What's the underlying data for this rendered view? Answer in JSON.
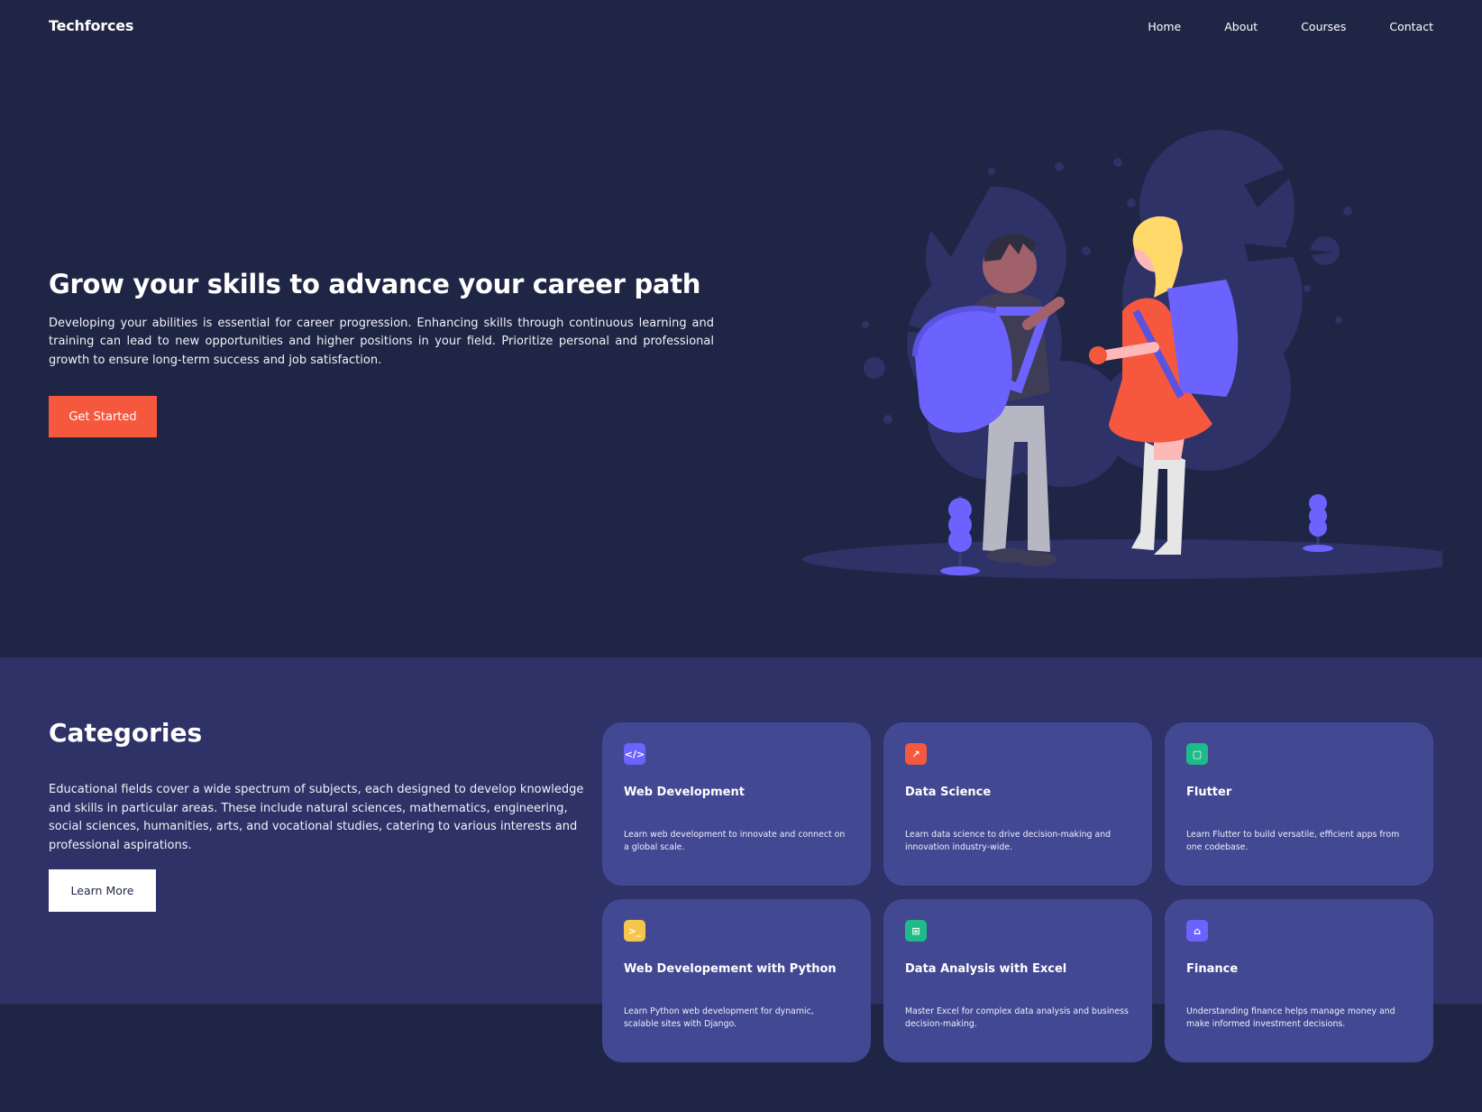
{
  "nav": {
    "brand": "Techforces",
    "links": [
      "Home",
      "About",
      "Courses",
      "Contact"
    ]
  },
  "hero": {
    "title": "Grow your skills to advance your career path",
    "description": "Developing your abilities is essential for career progression. Enhancing skills through continuous learning and training can lead to new opportunities and higher positions in your field. Prioritize personal and professional growth to ensure long-term success and job satisfaction.",
    "cta_label": "Get Started",
    "illustration": "two-students-with-backpacks"
  },
  "categories": {
    "title": "Categories",
    "description": "Educational fields cover a wide spectrum of subjects, each designed to develop knowledge and skills in particular areas. These include natural sciences, mathematics, engineering, social sciences, humanities, arts, and vocational studies, catering to various interests and professional aspirations.",
    "cta_label": "Learn More",
    "cards": [
      {
        "title": "Web Development",
        "description": "Learn web development to innovate and connect on a global scale.",
        "icon": "code-icon",
        "icon_color": "#6c63ff"
      },
      {
        "title": "Data Science",
        "description": "Learn data science to drive decision-making and innovation industry-wide.",
        "icon": "chart-icon",
        "icon_color": "#f6583e"
      },
      {
        "title": "Flutter",
        "description": "Learn Flutter to build versatile, efficient apps from one codebase.",
        "icon": "device-icon",
        "icon_color": "#1fba87"
      },
      {
        "title": "Web Developement with Python",
        "description": "Learn Python web development for dynamic, scalable sites with Django.",
        "icon": "terminal-icon",
        "icon_color": "#f5c64a"
      },
      {
        "title": "Data Analysis with Excel",
        "description": "Master Excel for complex data analysis and business decision-making.",
        "icon": "spreadsheet-icon",
        "icon_color": "#1fba87"
      },
      {
        "title": "Finance",
        "description": "Understanding finance helps manage money and make informed investment decisions.",
        "icon": "bank-icon",
        "icon_color": "#6c63ff"
      }
    ]
  },
  "colors": {
    "background": "#1f2544",
    "section": "#2f3267",
    "card": "#434893",
    "accent": "#f6583e",
    "illustration_purple": "#6c63ff"
  }
}
